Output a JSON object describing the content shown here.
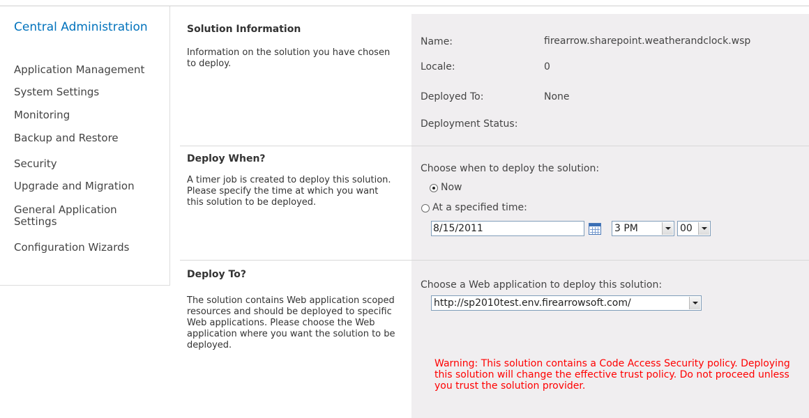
{
  "nav": {
    "root": "Central Administration",
    "items": [
      "Application Management",
      "System Settings",
      "Monitoring",
      "Backup and Restore",
      "Security",
      "Upgrade and Migration",
      "General Application Settings",
      "Configuration Wizards"
    ]
  },
  "solution_info": {
    "title": "Solution Information",
    "description": "Information on the solution you have chosen to deploy.",
    "name_label": "Name:",
    "name_value": "firearrow.sharepoint.weatherandclock.wsp",
    "locale_label": "Locale:",
    "locale_value": "0",
    "deployed_to_label": "Deployed To:",
    "deployed_to_value": "None",
    "status_label": "Deployment Status:"
  },
  "deploy_when": {
    "title": "Deploy When?",
    "description": "A timer job is created to deploy this solution. Please specify the time at which you want this solution to be deployed.",
    "prompt": "Choose when to deploy the solution:",
    "option_now": "Now",
    "option_specified": "At a specified time:",
    "date_value": "8/15/2011",
    "hour_value": "3 PM",
    "minute_value": "00"
  },
  "deploy_to": {
    "title": "Deploy To?",
    "description": "The solution contains Web application scoped resources and should be deployed to specific Web applications. Please choose the Web application where you want the solution to be deployed.",
    "prompt": "Choose a Web application to deploy this solution:",
    "webapp_value": "http://sp2010test.env.firearrowsoft.com/",
    "warning": "Warning: This solution contains a Code Access Security policy. Deploying this solution will change the effective trust policy. Do not proceed unless you trust the solution provider."
  },
  "colors": {
    "nav_link": "#0072bc",
    "section_bg": "#f0eef0",
    "warning": "#ff0000"
  }
}
